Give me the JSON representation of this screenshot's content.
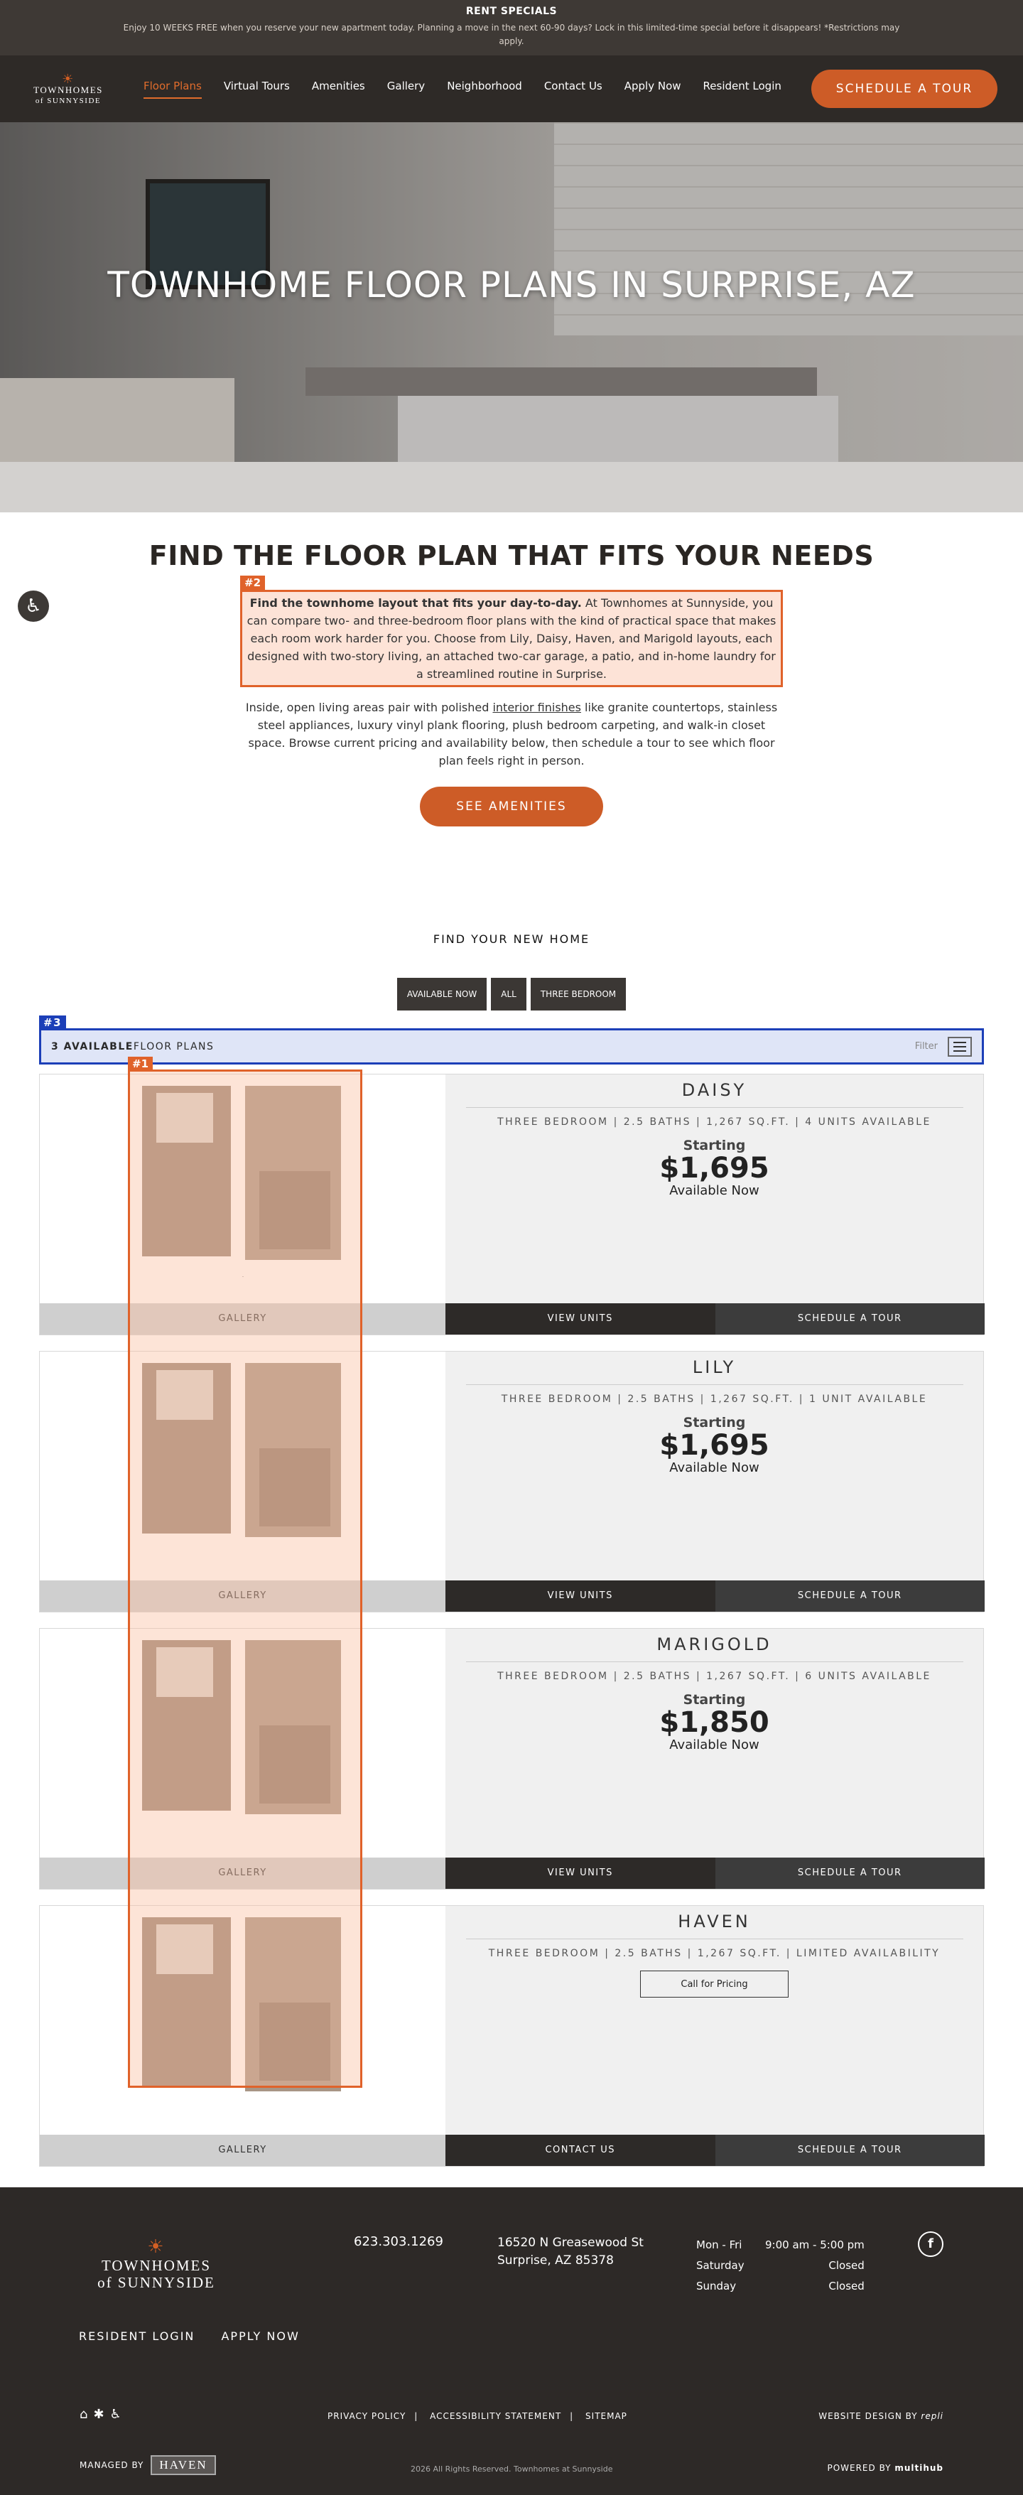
{
  "promo": {
    "title": "RENT SPECIALS",
    "text": "Enjoy 10 WEEKS FREE when you reserve your new apartment today. Planning a move in the next 60-90 days? Lock in this limited-time special before it disappears! *Restrictions may apply."
  },
  "nav": {
    "logo_top": "TOWNHOMES",
    "logo_bottom": "of SUNNYSIDE",
    "items": [
      "Floor Plans",
      "Virtual Tours",
      "Amenities",
      "Gallery",
      "Neighborhood",
      "Contact Us",
      "Apply Now",
      "Resident Login"
    ],
    "cta": "SCHEDULE A TOUR"
  },
  "hero": {
    "title": "TOWNHOME FLOOR PLANS IN SURPRISE, AZ"
  },
  "intro": {
    "heading": "FIND THE FLOOR PLAN THAT FITS YOUR NEEDS",
    "tag": "#2",
    "p1_bold": "Find the townhome layout that fits your day-to-day.",
    "p1_rest": " At Townhomes at Sunnyside, you can compare two- and three-bedroom floor plans with the kind of practical space that makes each room work harder for you. Choose from Lily, Daisy, Haven, and Marigold layouts, each designed with two-story living, an attached two-car garage, a patio, and in-home laundry for a streamlined routine in Surprise.",
    "p2_a": "Inside, open living areas pair with polished ",
    "p2_link": "interior finishes",
    "p2_b": " like granite countertops, stainless steel appliances, luxury vinyl plank flooring, plush bedroom carpeting, and walk-in closet space. Browse current pricing and availability below, then schedule a tour to see which floor plan feels right in person.",
    "button": "SEE AMENITIES"
  },
  "search": {
    "heading": "FIND YOUR NEW HOME",
    "filters": [
      "AVAILABLE NOW",
      "ALL",
      "THREE BEDROOM"
    ],
    "tag": "#3",
    "count": "3 AVAILABLE",
    "count_suffix": " FLOOR PLANS",
    "filter_label": "Filter"
  },
  "overlay_tag": "#1",
  "plans": [
    {
      "name": "DAISY",
      "spec": "THREE BEDROOM | 2.5 BATHS | 1,267 SQ.FT. | 4 UNITS AVAILABLE",
      "starting": "Starting",
      "price": "$1,695",
      "avail": "Available Now",
      "gallery": "GALLERY",
      "btn1": "VIEW UNITS",
      "btn2": "SCHEDULE A TOUR"
    },
    {
      "name": "LILY",
      "spec": "THREE BEDROOM | 2.5 BATHS | 1,267 SQ.FT. | 1 UNIT AVAILABLE",
      "starting": "Starting",
      "price": "$1,695",
      "avail": "Available Now",
      "gallery": "GALLERY",
      "btn1": "VIEW UNITS",
      "btn2": "SCHEDULE A TOUR"
    },
    {
      "name": "MARIGOLD",
      "spec": "THREE BEDROOM | 2.5 BATHS | 1,267 SQ.FT. | 6 UNITS AVAILABLE",
      "starting": "Starting",
      "price": "$1,850",
      "avail": "Available Now",
      "gallery": "GALLERY",
      "btn1": "VIEW UNITS",
      "btn2": "SCHEDULE A TOUR"
    },
    {
      "name": "HAVEN",
      "spec": "THREE BEDROOM | 2.5 BATHS | 1,267 SQ.FT. | LIMITED AVAILABILITY",
      "call": "Call for Pricing",
      "gallery": "GALLERY",
      "btn1": "CONTACT US",
      "btn2": "SCHEDULE A TOUR"
    }
  ],
  "footer": {
    "logo_top": "TOWNHOMES",
    "logo_bottom": "of SUNNYSIDE",
    "phone": "623.303.1269",
    "addr1": "16520 N Greasewood St",
    "addr2": "Surprise, AZ 85378",
    "hours": [
      [
        "Mon - Fri",
        "9:00 am - 5:00 pm"
      ],
      [
        "Saturday",
        "Closed"
      ],
      [
        "Sunday",
        "Closed"
      ]
    ],
    "links": [
      "RESIDENT LOGIN",
      "APPLY NOW"
    ],
    "legal": [
      "PRIVACY POLICY",
      "ACCESSIBILITY STATEMENT",
      "SITEMAP"
    ],
    "design": "WEBSITE DESIGN BY",
    "design_brand": "repli",
    "managed": "MANAGED BY",
    "haven": "HAVEN",
    "copyright": "2026 All Rights Reserved. Townhomes at Sunnyside",
    "powered": "POWERED BY",
    "powered_brand": "multihub"
  },
  "colors": {
    "accent": "#cd5c27",
    "dark": "#2d2a28",
    "annot_orange": "#e0622a",
    "annot_blue": "#1c3fb8"
  }
}
